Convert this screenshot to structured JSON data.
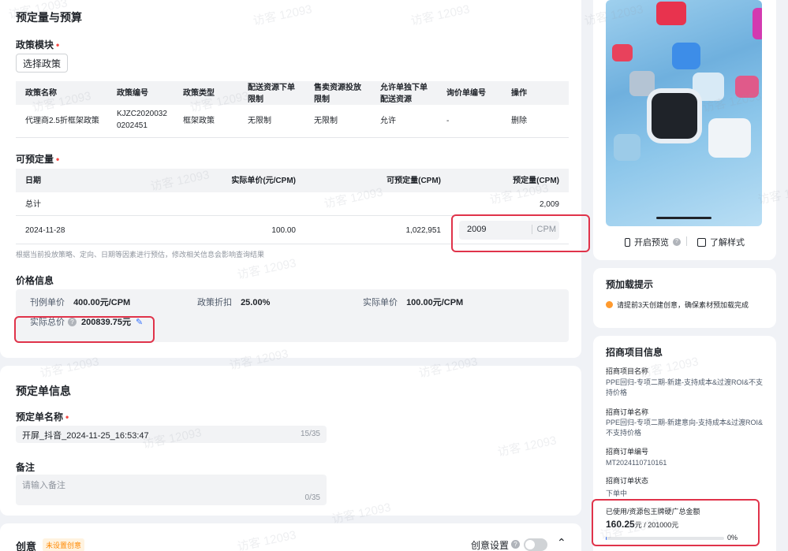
{
  "budget": {
    "title": "预定量与预算",
    "policy_module": {
      "label": "政策模块",
      "select_button": "选择政策",
      "columns": [
        "政策名称",
        "政策编号",
        "政策类型",
        "配送资源下单限制",
        "售卖资源投放限制",
        "允许单独下单配送资源",
        "询价单编号",
        "操作"
      ],
      "row": {
        "name": "代理商2.5折框架政策",
        "code": "KJZC20200320202451",
        "type": "框架政策",
        "delivery_limit": "无限制",
        "sale_limit": "无限制",
        "allow_single": "允许",
        "inquiry_no": "-",
        "action": "删除"
      }
    },
    "reservable": {
      "label": "可预定量",
      "columns": [
        "日期",
        "实际单价(元/CPM)",
        "可预定量(CPM)",
        "预定量(CPM)"
      ],
      "total_label": "总计",
      "total_value": "2,009",
      "row": {
        "date": "2024-11-28",
        "unit_price": "100.00",
        "available": "1,022,951",
        "quantity": "2009",
        "unit": "CPM"
      },
      "note": "根据当前投放策略、定向、日期等因素进行预估，修改相关信息会影响查询结果"
    },
    "price": {
      "label": "价格信息",
      "list_price_label": "刊例单价",
      "list_price_value": "400.00元/CPM",
      "discount_label": "政策折扣",
      "discount_value": "25.00%",
      "actual_price_label": "实际单价",
      "actual_price_value": "100.00元/CPM",
      "total_label": "实际总价",
      "total_value": "200839.75元"
    }
  },
  "order": {
    "title": "预定单信息",
    "name_label": "预定单名称",
    "name_value": "开屏_抖音_2024-11-25_16:53:47",
    "name_count": "15/35",
    "remark_label": "备注",
    "remark_placeholder": "请输入备注",
    "remark_count": "0/35"
  },
  "creative": {
    "title": "创意",
    "badge": "未设置创意",
    "settings_label": "创意设置",
    "toggle_on": false
  },
  "preview": {
    "open_preview": "开启预览",
    "learn_style": "了解样式"
  },
  "preload": {
    "title": "预加载提示",
    "tip": "请提前3天创建创意，确保素材预加载完成"
  },
  "project": {
    "title": "招商项目信息",
    "fields": [
      {
        "label": "招商项目名称",
        "value": "PPE回归-专项二期-新建-支持成本&过渡ROI&不支持价格"
      },
      {
        "label": "招商订单名称",
        "value": "PPE回归-专项二期-新建意向-支持成本&过渡ROI&不支持价格"
      },
      {
        "label": "招商订单编号",
        "value": "MT2024110710161"
      },
      {
        "label": "招商订单状态",
        "value": "下单中"
      }
    ],
    "usage_label": "已使用/资源包王牌硬广总金额",
    "usage_used": "160.25",
    "usage_unit": "元",
    "usage_total": "/ 201000元",
    "usage_percent": "0%",
    "usage_fraction": 0.0008
  },
  "watermark": "访客 12093",
  "colors": {
    "highlight": "#e0334a",
    "primary": "#3370ff",
    "required": "#f54a45",
    "warning": "#ff9a2e",
    "badge_bg": "#fff3e0",
    "badge_text": "#ff8800"
  }
}
